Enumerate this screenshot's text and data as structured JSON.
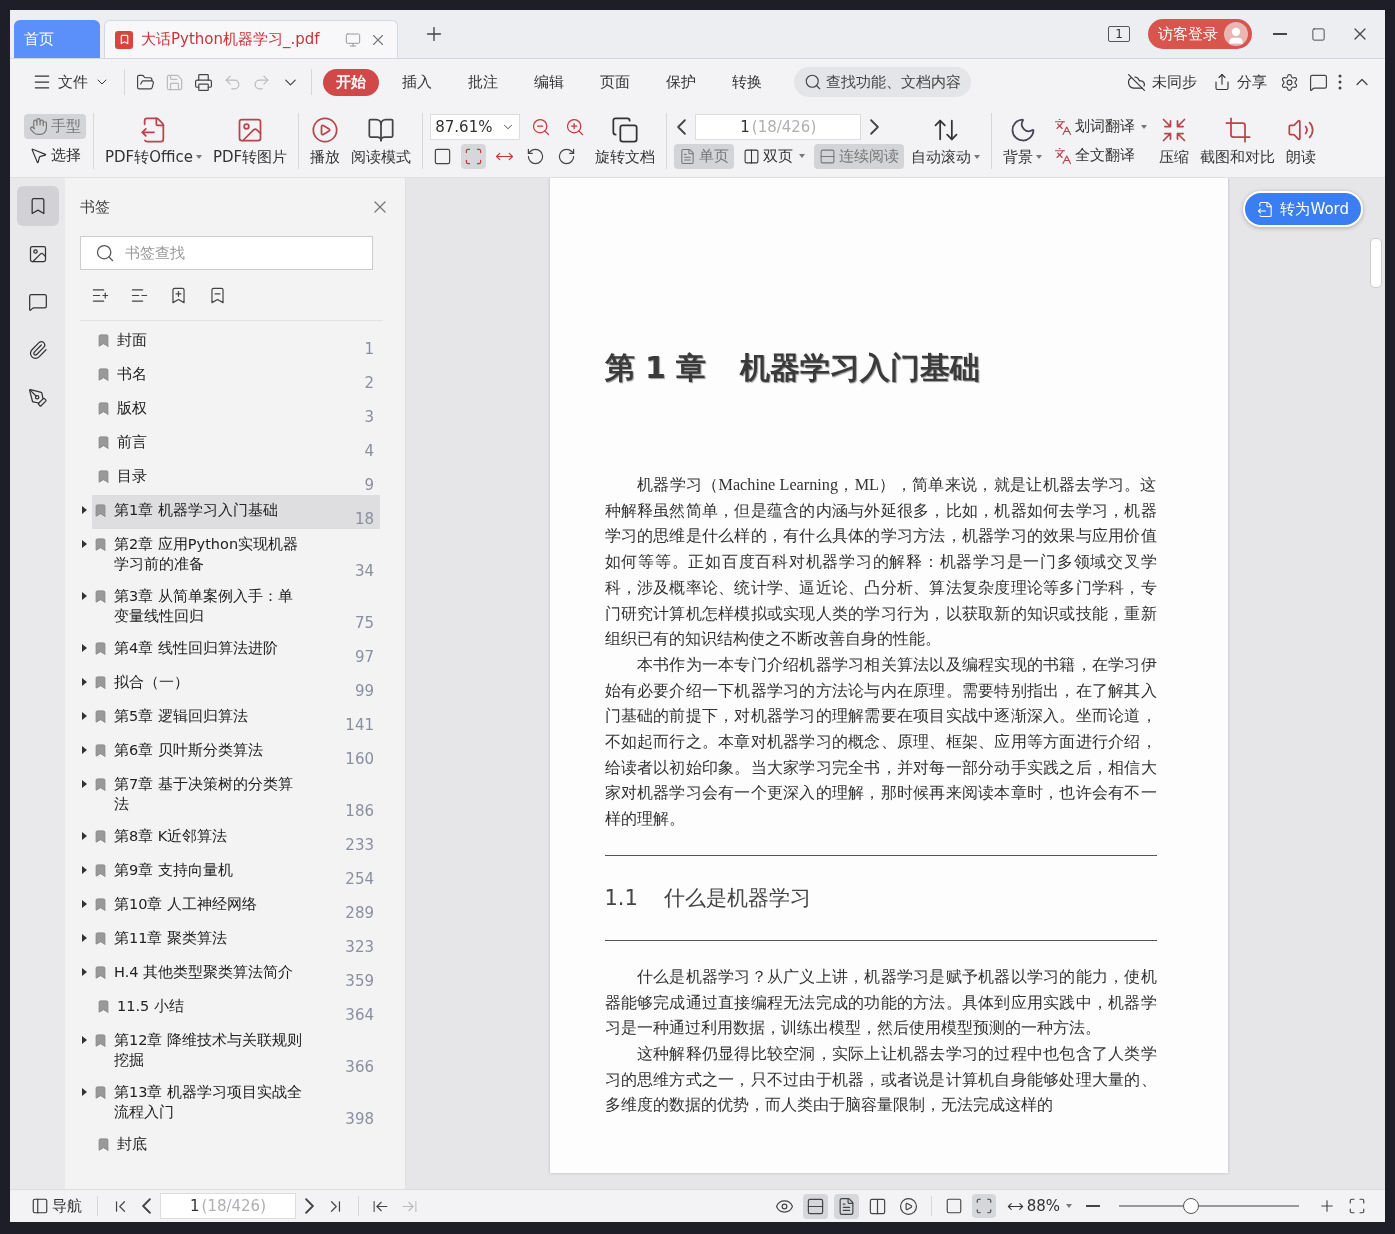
{
  "tabs": [
    {
      "label": "首页",
      "kind": "home",
      "selected": false
    },
    {
      "label": "大话Python机器学习_.pdf",
      "kind": "doc",
      "selected": true
    }
  ],
  "title_bar": {
    "page_badge": "1",
    "login": "访客登录"
  },
  "menu": {
    "file": "文件",
    "tabs": [
      {
        "label": "开始",
        "selected": true
      },
      {
        "label": "插入",
        "selected": false
      },
      {
        "label": "批注",
        "selected": false
      },
      {
        "label": "编辑",
        "selected": false
      },
      {
        "label": "页面",
        "selected": false
      },
      {
        "label": "保护",
        "selected": false
      },
      {
        "label": "转换",
        "selected": false
      }
    ],
    "search": {
      "placeholder": "查找功能、文档内容"
    },
    "sync": "未同步",
    "share": "分享"
  },
  "ribbon": {
    "pointer_tools": [
      {
        "label": "手型",
        "selected": true
      },
      {
        "label": "选择",
        "selected": false
      }
    ],
    "convert_tools": [
      {
        "label": "PDF转Office",
        "dropdown": true
      },
      {
        "label": "PDF转图片",
        "dropdown": false
      }
    ],
    "view_tools": [
      {
        "label": "播放"
      },
      {
        "label": "阅读模式"
      }
    ],
    "zoom": {
      "value": "87.61%"
    },
    "fit_modes": [
      {
        "selected": false
      },
      {
        "selected": true
      },
      {
        "selected": false
      }
    ],
    "rotate": {
      "label": "旋转文档"
    },
    "page": {
      "value": "1",
      "total": "(18/426)"
    },
    "layout_modes": [
      {
        "label": "单页",
        "selected": true,
        "dropdown": false
      },
      {
        "label": "双页",
        "selected": false,
        "dropdown": true
      },
      {
        "label": "连续阅读",
        "selected": true,
        "dropdown": false
      }
    ],
    "auto_scroll": {
      "label": "自动滚动",
      "dropdown": true
    },
    "tools": [
      {
        "kind": "big",
        "label": "背景",
        "dropdown": true
      },
      {
        "kind": "stack",
        "items": [
          {
            "label": "划词翻译",
            "dropdown": true
          },
          {
            "label": "全文翻译",
            "dropdown": false
          }
        ]
      },
      {
        "kind": "big",
        "label": "压缩",
        "dropdown": false
      },
      {
        "kind": "big",
        "label": "截图和对比",
        "dropdown": false
      },
      {
        "kind": "big",
        "label": "朗读",
        "dropdown": false
      }
    ]
  },
  "side_rail": [
    {
      "selected": true
    },
    {
      "selected": false
    },
    {
      "selected": false
    },
    {
      "selected": false
    },
    {
      "selected": false
    }
  ],
  "bookmarks": {
    "title": "书签",
    "search": {
      "placeholder": "书签查找"
    },
    "items": [
      {
        "label": "封面",
        "page": "1",
        "expandable": false,
        "selected": false
      },
      {
        "label": "书名",
        "page": "2",
        "expandable": false,
        "selected": false
      },
      {
        "label": "版权",
        "page": "3",
        "expandable": false,
        "selected": false
      },
      {
        "label": "前言",
        "page": "4",
        "expandable": false,
        "selected": false
      },
      {
        "label": "目录",
        "page": "9",
        "expandable": false,
        "selected": false
      },
      {
        "label": "第1章 机器学习入门基础",
        "page": "18",
        "expandable": true,
        "selected": true
      },
      {
        "label": "第2章 应用Python实现机器学习前的准备",
        "page": "34",
        "expandable": true,
        "selected": false
      },
      {
        "label": "第3章 从简单案例入手：单变量线性回归",
        "page": "75",
        "expandable": true,
        "selected": false
      },
      {
        "label": "第4章 线性回归算法进阶",
        "page": "97",
        "expandable": true,
        "selected": false
      },
      {
        "label": "拟合（一）",
        "page": "99",
        "expandable": true,
        "selected": false
      },
      {
        "label": "第5章 逻辑回归算法",
        "page": "141",
        "expandable": true,
        "selected": false
      },
      {
        "label": "第6章 贝叶斯分类算法",
        "page": "160",
        "expandable": true,
        "selected": false
      },
      {
        "label": "第7章 基于决策树的分类算法",
        "page": "186",
        "expandable": true,
        "selected": false
      },
      {
        "label": "第8章 K近邻算法",
        "page": "233",
        "expandable": true,
        "selected": false
      },
      {
        "label": "第9章 支持向量机",
        "page": "254",
        "expandable": true,
        "selected": false
      },
      {
        "label": "第10章 人工神经网络",
        "page": "289",
        "expandable": true,
        "selected": false
      },
      {
        "label": "第11章 聚类算法",
        "page": "323",
        "expandable": true,
        "selected": false
      },
      {
        "label": "H.4 其他类型聚类算法简介",
        "page": "359",
        "expandable": true,
        "selected": false
      },
      {
        "label": "11.5 小结",
        "page": "364",
        "expandable": false,
        "selected": false
      },
      {
        "label": "第12章 降维技术与关联规则挖掘",
        "page": "366",
        "expandable": true,
        "selected": false
      },
      {
        "label": "第13章 机器学习项目实战全流程入门",
        "page": "398",
        "expandable": true,
        "selected": false
      },
      {
        "label": "封底",
        "expandable": false,
        "selected": false
      }
    ]
  },
  "document": {
    "convert_button": "转为Word",
    "chapter_number": "第 1 章",
    "chapter_title": "机器学习入门基础",
    "paragraphs_before": [
      "机器学习（Machine Learning，ML），简单来说，就是让机器去学习。这种解释虽然简单，但是蕴含的内涵与外延很多，比如，机器如何去学习，机器学习的思维是什么样的，有什么具体的学习方法，机器学习的效果与应用价值如何等等。正如百度百科对机器学习的解释：机器学习是一门多领域交叉学科，涉及概率论、统计学、逼近论、凸分析、算法复杂度理论等多门学科，专门研究计算机怎样模拟或实现人类的学习行为，以获取新的知识或技能，重新组织已有的知识结构使之不断改善自身的性能。",
      "本书作为一本专门介绍机器学习相关算法以及编程实现的书籍，在学习伊始有必要介绍一下机器学习的方法论与内在原理。需要特别指出，在了解其入门基础的前提下，对机器学习的理解需要在项目实战中逐渐深入。坐而论道，不如起而行之。本章对机器学习的概念、原理、框架、应用等方面进行介绍，给读者以初始印象。当大家学习完全书，并对每一部分动手实践之后，相信大家对机器学习会有一个更深入的理解，那时候再来阅读本章时，也许会有不一样的理解。"
    ],
    "section_number": "1.1",
    "section_title": "什么是机器学习",
    "paragraphs_after": [
      "什么是机器学习？从广义上讲，机器学习是赋予机器以学习的能力，使机器能够完成通过直接编程无法完成的功能的方法。具体到应用实践中，机器学习是一种通过利用数据，训练出模型，然后使用模型预测的一种方法。",
      "这种解释仍显得比较空洞，实际上让机器去学习的过程中也包含了人类学习的思维方式之一，只不过由于机器，或者说是计算机自身能够处理大量的、多维度的数据的优势，而人类由于脑容量限制，无法完成这样的"
    ]
  },
  "status_bar": {
    "nav": "导航",
    "page": {
      "value": "1",
      "total": "(18/426)"
    },
    "view_toggles": [
      {
        "selected": false
      },
      {
        "selected": true
      },
      {
        "selected": true
      },
      {
        "selected": false
      }
    ],
    "fit_modes": [
      {
        "selected": false
      },
      {
        "selected": true
      }
    ],
    "zoom": {
      "value": "88%",
      "dropdown": true,
      "level": 0.4
    }
  }
}
